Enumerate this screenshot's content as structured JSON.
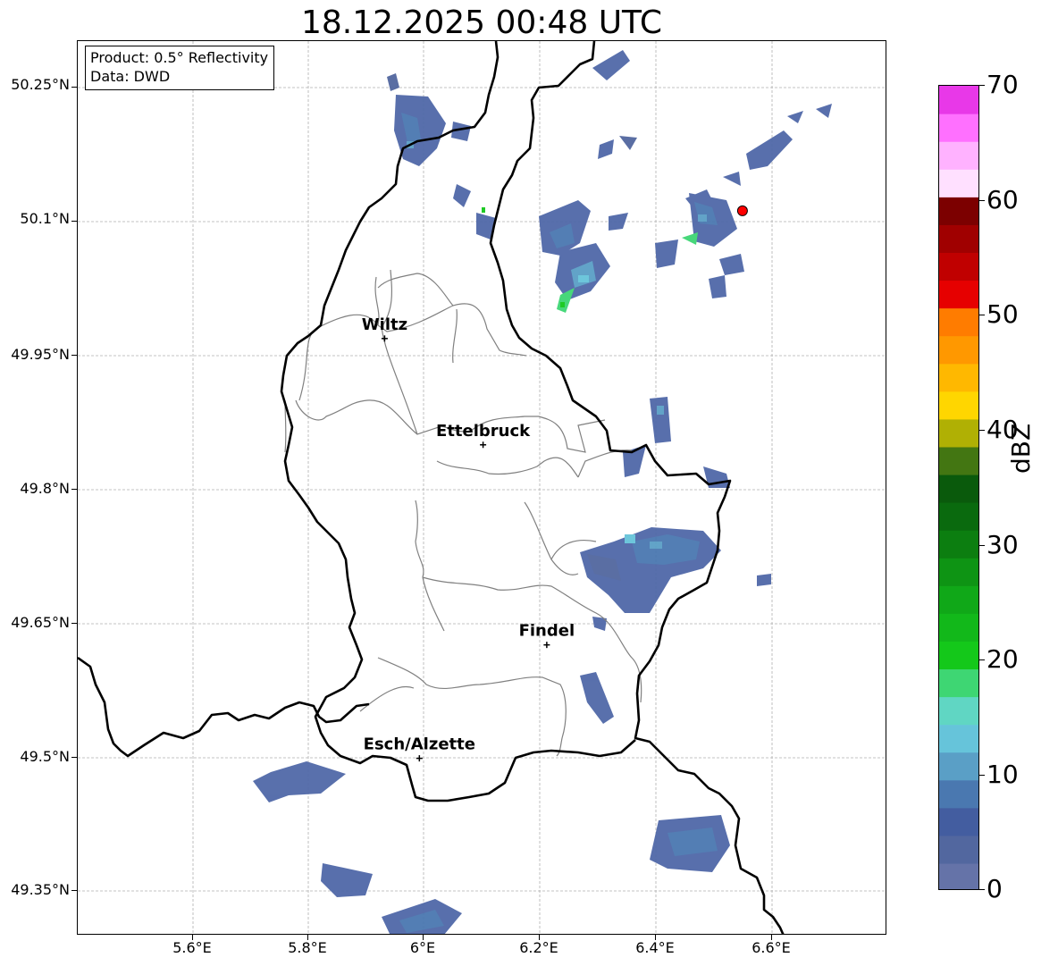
{
  "title": "18.12.2025 00:48 UTC",
  "info": {
    "product": "Product: 0.5° Reflectivity",
    "data": "Data: DWD"
  },
  "axes": {
    "lat_ticks": [
      "50.25°N",
      "50.1°N",
      "49.95°N",
      "49.8°N",
      "49.65°N",
      "49.5°N",
      "49.35°N"
    ],
    "lon_ticks": [
      "5.6°E",
      "5.8°E",
      "6°E",
      "6.2°E",
      "6.4°E",
      "6.6°E"
    ],
    "grid": true
  },
  "cities": [
    {
      "name": "Wiltz",
      "lon": 5.93,
      "lat": 49.967
    },
    {
      "name": "Ettelbruck",
      "lon": 6.1,
      "lat": 49.848
    },
    {
      "name": "Findel",
      "lon": 6.21,
      "lat": 49.624
    },
    {
      "name": "Esch/Alzette",
      "lon": 5.99,
      "lat": 49.497
    }
  ],
  "radar_site": {
    "lon": 6.548,
    "lat": 50.11,
    "color": "#ff0000"
  },
  "colorbar": {
    "label": "dBZ",
    "ticks": [
      "70",
      "60",
      "50",
      "40",
      "30",
      "20",
      "10",
      "0"
    ],
    "min": 0,
    "max": 70,
    "step": 2.5,
    "colors": [
      "#6573a8",
      "#52679f",
      "#435da0",
      "#4a78b0",
      "#5a9fc6",
      "#66c4da",
      "#60d6c3",
      "#3ed673",
      "#14c81a",
      "#12b81a",
      "#10a818",
      "#0e9414",
      "#0c7e10",
      "#0a6a0e",
      "#0a5a0c",
      "#437612",
      "#b0b004",
      "#ffd600",
      "#ffb800",
      "#ff9800",
      "#ff7c00",
      "#e60000",
      "#c00000",
      "#a00000",
      "#7c0000",
      "#ffe0ff",
      "#ffb2ff",
      "#ff70ff",
      "#e838e8"
    ]
  },
  "colors": {
    "border_country": "#000000",
    "border_canton": "#808080",
    "grid": "#b0b0b0"
  }
}
